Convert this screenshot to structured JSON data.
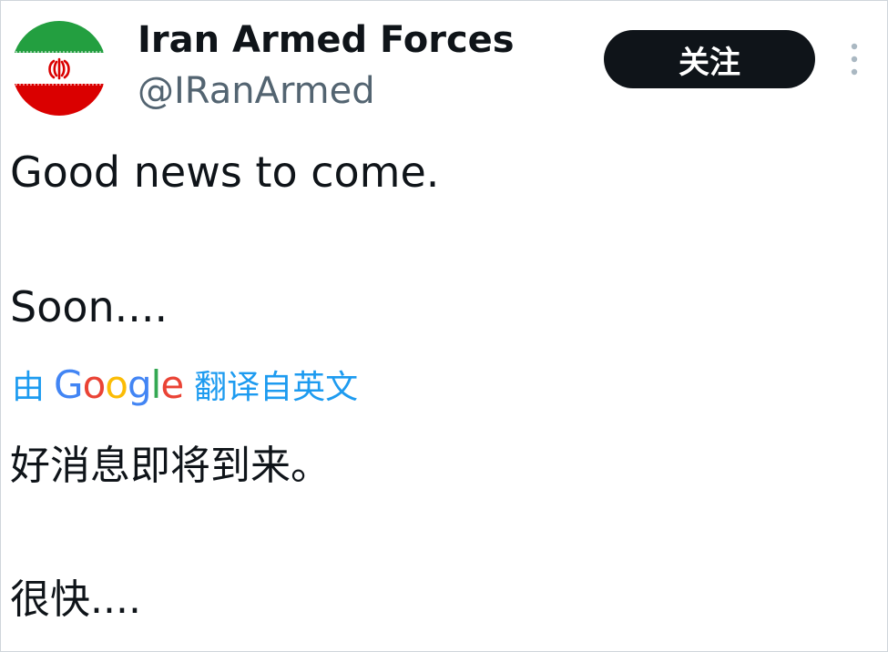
{
  "author": {
    "name": "Iran Armed Forces",
    "handle": "@IRanArmed",
    "avatar_icon": "iran-flag-avatar",
    "avatar_colors": {
      "green": "#239f40",
      "white": "#ffffff",
      "red": "#da0000"
    }
  },
  "follow_button": {
    "label": "关注",
    "background": "#0f1419",
    "text_color": "#ffffff"
  },
  "more_menu": {
    "icon": "more-vertical-icon"
  },
  "tweet": {
    "line1": "Good news to come.",
    "line2": "Soon...."
  },
  "translation": {
    "prefix": "由",
    "provider": "Google",
    "suffix": "翻译自英文",
    "link_color": "#1d9bf0",
    "line1": "好消息即将到来。",
    "line2": "很快...."
  }
}
